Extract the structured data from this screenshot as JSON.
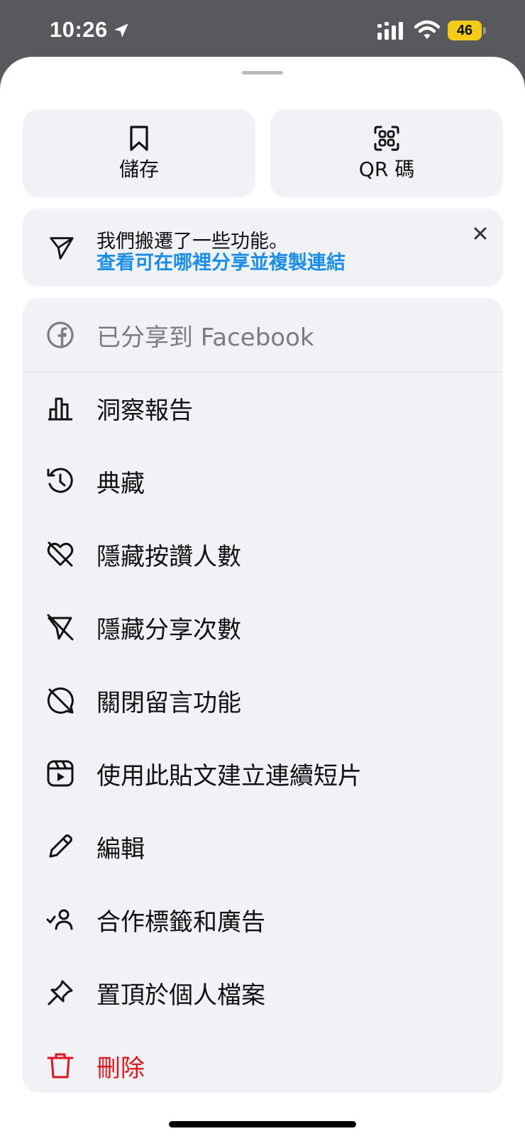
{
  "status_bar": {
    "time": "10:26",
    "battery": "46"
  },
  "tiles": [
    {
      "label": "儲存",
      "icon": "bookmark-icon"
    },
    {
      "label": "QR 碼",
      "icon": "qr-code-icon"
    }
  ],
  "notice": {
    "title": "我們搬遷了一些功能。",
    "link": "查看可在哪裡分享並複製連結",
    "icon": "paper-plane-icon",
    "close_icon": "close-icon"
  },
  "menu": {
    "items": [
      {
        "label": "已分享到 Facebook",
        "icon": "facebook-icon"
      },
      {
        "label": "洞察報告",
        "icon": "bar-chart-icon"
      },
      {
        "label": "典藏",
        "icon": "archive-history-icon"
      },
      {
        "label": "隱藏按讚人數",
        "icon": "heart-off-icon"
      },
      {
        "label": "隱藏分享次數",
        "icon": "share-off-icon"
      },
      {
        "label": "關閉留言功能",
        "icon": "comment-off-icon"
      },
      {
        "label": "使用此貼文建立連續短片",
        "icon": "reels-icon"
      },
      {
        "label": "編輯",
        "icon": "pencil-icon"
      },
      {
        "label": "合作標籤和廣告",
        "icon": "partner-tag-icon"
      },
      {
        "label": "置頂於個人檔案",
        "icon": "pin-icon"
      },
      {
        "label": "刪除",
        "icon": "trash-icon"
      }
    ]
  },
  "colors": {
    "link": "#1c8ee6",
    "danger": "#e0141e",
    "panel": "#f1f2f5",
    "battery": "#f4cc17"
  }
}
